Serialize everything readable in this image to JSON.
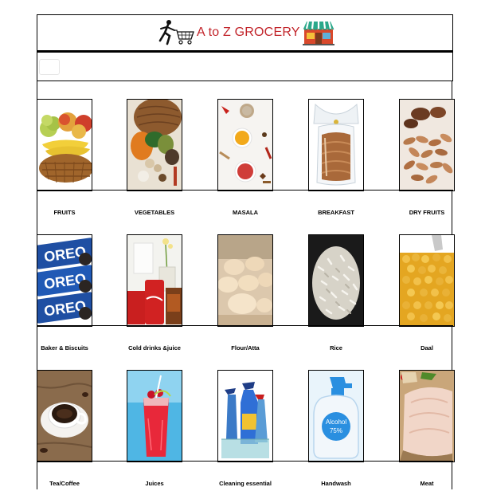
{
  "header": {
    "title": "A to Z GROCERY",
    "runner_icon": "shopping-runner-icon",
    "store_icon": "store-front-icon"
  },
  "navbar": {
    "toggle_icon": "menu-toggle-icon"
  },
  "categories": [
    {
      "label": "FRUITS",
      "image": "fruits-basket"
    },
    {
      "label": "VEGETABLES",
      "image": "vegetables-basket"
    },
    {
      "label": "MASALA",
      "image": "masala-spices"
    },
    {
      "label": "BREAKFAST",
      "image": "bread-loaf"
    },
    {
      "label": "DRY FRUITS",
      "image": "almonds"
    },
    {
      "label": "Baker & Biscuits",
      "image": "oreo-biscuits"
    },
    {
      "label": "Cold drinks &juice",
      "image": "cola-cans"
    },
    {
      "label": "Flour/Atta",
      "image": "dough-balls"
    },
    {
      "label": "Rice",
      "image": "rice-grains"
    },
    {
      "label": "Daal",
      "image": "chana-daal"
    },
    {
      "label": "Tea/Coffee",
      "image": "coffee-cup"
    },
    {
      "label": "Juices",
      "image": "red-juice-glass"
    },
    {
      "label": "Cleaning essential",
      "image": "cleaning-bottles"
    },
    {
      "label": "Handwash",
      "image": "alcohol-handwash"
    },
    {
      "label": "Meat",
      "image": "chicken-breast"
    }
  ],
  "handwash_bottle": {
    "line1": "Alcohol",
    "line2": "75%"
  },
  "colors": {
    "title_red": "#c2252b",
    "store_green": "#2aa88a"
  }
}
